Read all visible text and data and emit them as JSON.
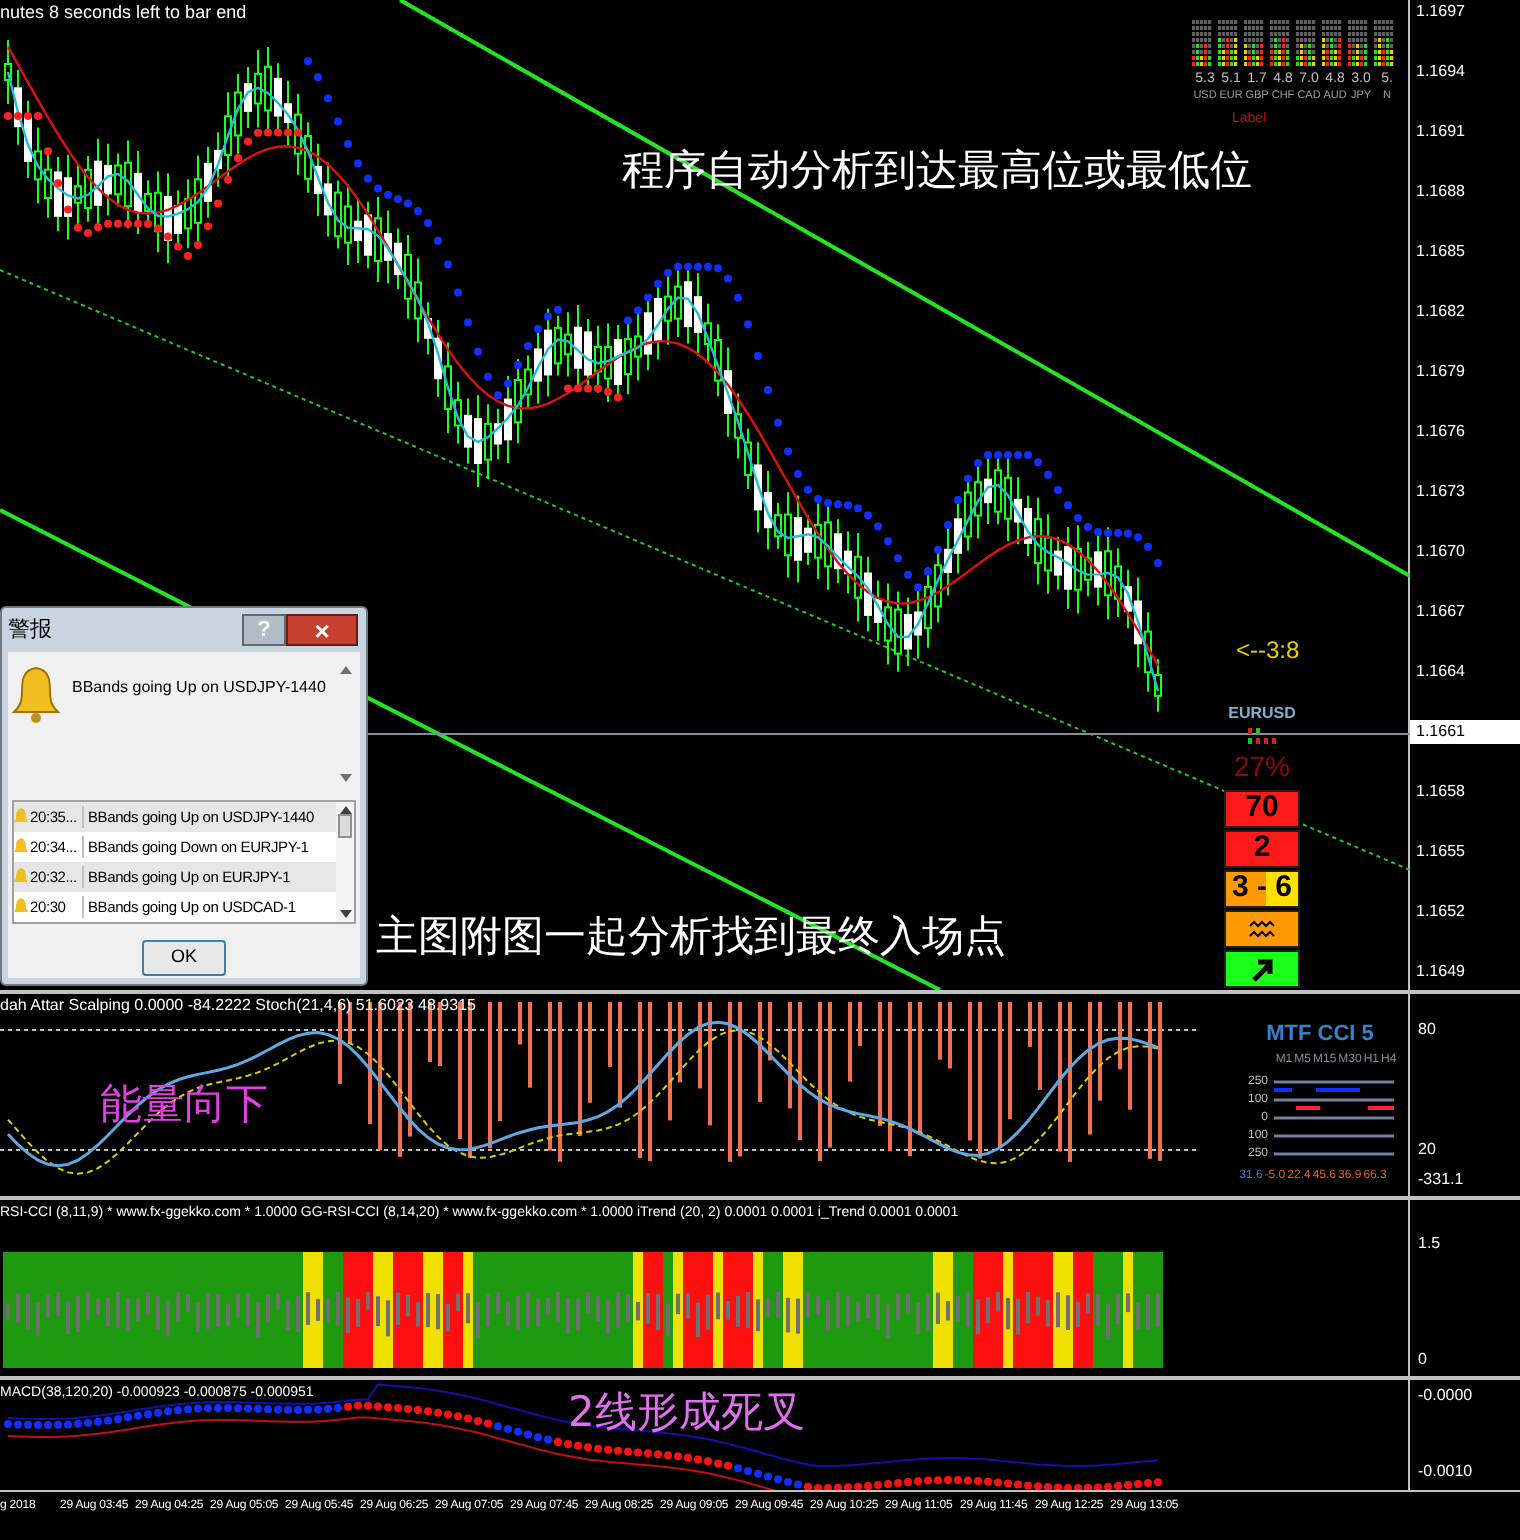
{
  "timer_text": "nutes 8 seconds left to bar end",
  "currency_strength": {
    "items": [
      {
        "value": "5.3",
        "currency": "USD"
      },
      {
        "value": "5.1",
        "currency": "EUR"
      },
      {
        "value": "1.7",
        "currency": "GBP"
      },
      {
        "value": "4.8",
        "currency": "CHF"
      },
      {
        "value": "7.0",
        "currency": "CAD"
      },
      {
        "value": "4.8",
        "currency": "AUD"
      },
      {
        "value": "3.0",
        "currency": "JPY"
      },
      {
        "value": "5.",
        "currency": "N"
      }
    ],
    "label": "Label"
  },
  "annotations": {
    "top": "程序自动分析到达最高位或最低位",
    "bottom": "主图附图一起分析找到最终入场点"
  },
  "countdown": "<--3:8",
  "signal_panel": {
    "symbol": "EURUSD",
    "percent": "27%",
    "cells": [
      {
        "kind": "text",
        "text": "70",
        "color": "#ff1a1a"
      },
      {
        "kind": "text",
        "text": "2",
        "color": "#ff1a1a"
      },
      {
        "kind": "split",
        "text": "3 - 6",
        "color": "#ff9900"
      },
      {
        "kind": "wave",
        "color": "#ff9900"
      },
      {
        "kind": "arrow",
        "color": "#1aff1a"
      }
    ]
  },
  "price_axis": [
    {
      "label": "1.1697",
      "current": false
    },
    {
      "label": "1.1694",
      "current": false
    },
    {
      "label": "1.1691",
      "current": false
    },
    {
      "label": "1.1688",
      "current": false
    },
    {
      "label": "1.1685",
      "current": false
    },
    {
      "label": "1.1682",
      "current": false
    },
    {
      "label": "1.1679",
      "current": false
    },
    {
      "label": "1.1676",
      "current": false
    },
    {
      "label": "1.1673",
      "current": false
    },
    {
      "label": "1.1670",
      "current": false
    },
    {
      "label": "1.1667",
      "current": false
    },
    {
      "label": "1.1664",
      "current": false
    },
    {
      "label": "1.1661",
      "current": true
    },
    {
      "label": "1.1658",
      "current": false
    },
    {
      "label": "1.1655",
      "current": false
    },
    {
      "label": "1.1652",
      "current": false
    },
    {
      "label": "1.1649",
      "current": false
    }
  ],
  "alert_dialog": {
    "title": "警报",
    "help": "?",
    "close": "×",
    "message": "BBands going Up on USDJPY-1440",
    "rows": [
      {
        "time": "20:35...",
        "message": "BBands going Up on USDJPY-1440"
      },
      {
        "time": "20:34...",
        "message": "BBands going Down on EURJPY-1"
      },
      {
        "time": "20:32...",
        "message": "BBands going Up on EURJPY-1"
      },
      {
        "time": "20:30",
        "message": "BBands going Up on USDCAD-1"
      }
    ],
    "ok": "OK"
  },
  "stoch_panel": {
    "header": "dah Attar Scalping 0.0000 -84.2222  Stoch(21,4,6) 51.6023 48.9315",
    "annotation": "能量向下",
    "axis": [
      "80",
      "20",
      "-331.1"
    ],
    "mtf_cci": {
      "title": "MTF CCI 5",
      "columns": [
        "M1",
        "M5",
        "M15",
        "M30",
        "H1",
        "H4"
      ],
      "levels": [
        "250",
        "100",
        "0",
        "100",
        "250"
      ],
      "values": [
        {
          "text": "31.6",
          "color": "#3a7fd0"
        },
        {
          "text": "-5.0",
          "color": "#e06020"
        },
        {
          "text": "22.4",
          "color": "#e06020"
        },
        {
          "text": "45.6",
          "color": "#e06020"
        },
        {
          "text": "36.9",
          "color": "#e06020"
        },
        {
          "text": "66.3",
          "color": "#e06020"
        }
      ]
    }
  },
  "rsi_panel": {
    "header": "RSI-CCI (8,11,9) * www.fx-ggekko.com * 1.0000  GG-RSI-CCI (8,14,20) * www.fx-ggekko.com * 1.0000  iTrend (20, 2) 0.0001 0.0001  i_Trend 0.0001 0.0001",
    "axis": [
      "1.5",
      "0"
    ]
  },
  "macd_panel": {
    "header": "MACD(38,120,20) -0.000923 -0.000875 -0.000951",
    "annotation": "2线形成死叉",
    "axis": [
      "-0.0000",
      "-0.0010"
    ]
  },
  "time_axis": [
    "g 2018",
    "29 Aug 03:45",
    "29 Aug 04:25",
    "29 Aug 05:05",
    "29 Aug 05:45",
    "29 Aug 06:25",
    "29 Aug 07:05",
    "29 Aug 07:45",
    "29 Aug 08:25",
    "29 Aug 09:05",
    "29 Aug 09:45",
    "29 Aug 10:25",
    "29 Aug 11:05",
    "29 Aug 11:45",
    "29 Aug 12:25",
    "29 Aug 13:05"
  ]
}
